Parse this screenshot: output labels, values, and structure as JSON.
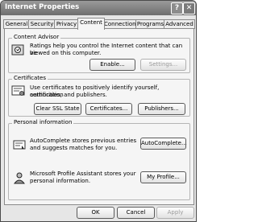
{
  "window": {
    "title": "Internet Properties",
    "help_glyph": "?",
    "close_glyph": "✕"
  },
  "tabs": [
    {
      "label": "General"
    },
    {
      "label": "Security"
    },
    {
      "label": "Privacy"
    },
    {
      "label": "Content",
      "active": true
    },
    {
      "label": "Connections"
    },
    {
      "label": "Programs"
    },
    {
      "label": "Advanced"
    }
  ],
  "content_advisor": {
    "title": "Content Advisor",
    "text_line1": "Ratings help you control the Internet content that can be",
    "text_line2": "viewed on this computer.",
    "enable_button": "Enable...",
    "settings_button": "Settings..."
  },
  "certificates": {
    "title": "Certificates",
    "text_line1": "Use certificates to positively identify yourself, certification",
    "text_line2": "authorities, and publishers.",
    "clear_ssl_button": "Clear SSL State",
    "certificates_button": "Certificates...",
    "publishers_button": "Publishers..."
  },
  "personal": {
    "title": "Personal information",
    "autocomplete_line1": "AutoComplete stores previous entries",
    "autocomplete_line2": "and suggests matches for you.",
    "autocomplete_button": "AutoComplete...",
    "profile_line1": "Microsoft Profile Assistant stores your",
    "profile_line2": "personal information.",
    "profile_button": "My Profile..."
  },
  "footer": {
    "ok": "OK",
    "cancel": "Cancel",
    "apply": "Apply"
  },
  "icons": [
    "help-icon",
    "close-icon",
    "content-advisor-icon",
    "certificate-icon",
    "autocomplete-icon",
    "profile-icon"
  ]
}
